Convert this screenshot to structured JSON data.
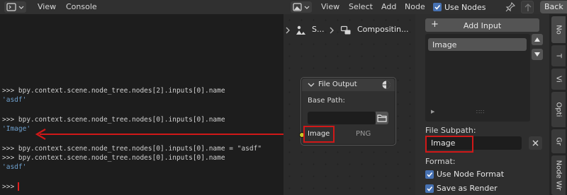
{
  "console": {
    "menus": [
      "View",
      "Console"
    ],
    "lines": [
      {
        "kind": "cmd",
        "text": ">>> bpy.context.scene.node_tree.nodes[2].inputs[0].name"
      },
      {
        "kind": "out",
        "text": "'asdf'"
      },
      {
        "kind": "cmd",
        "text": ">>> bpy.context.scene.node_tree.nodes[0].inputs[0].name"
      },
      {
        "kind": "out",
        "text": "'Image'"
      },
      {
        "kind": "cmd",
        "text": ">>> bpy.context.scene.node_tree.nodes[0].inputs[0].name = \"asdf\""
      },
      {
        "kind": "cmd",
        "text": ">>> bpy.context.scene.node_tree.nodes[0].inputs[0].name"
      },
      {
        "kind": "out",
        "text": "'asdf'"
      }
    ],
    "prompt": ">>>"
  },
  "node_editor": {
    "menus": [
      "View",
      "Select",
      "Add",
      "Node"
    ],
    "use_nodes_label": "Use Nodes",
    "use_nodes_checked": true,
    "back_label": "Back",
    "breadcrumbs": [
      "S...",
      "Compositin..."
    ],
    "node": {
      "title": "File Output",
      "base_path_label": "Base Path:",
      "base_path_value": "",
      "input_label": "Image",
      "format_label": "PNG"
    }
  },
  "sidebar": {
    "add_input_label": "Add Input",
    "list_items": [
      "Image"
    ],
    "file_subpath_label": "File Subpath:",
    "file_subpath_value": "Image",
    "format_label": "Format:",
    "use_node_format_label": "Use Node Format",
    "use_node_format_checked": true,
    "save_as_render_label": "Save as Render",
    "save_as_render_checked": true
  },
  "tabs": [
    "No",
    "T",
    "Vi",
    "Opti",
    "Gr",
    "Node Wr"
  ],
  "colors": {
    "highlight": "#d01818",
    "accent": "#4772b3",
    "socket": "#c7c729",
    "output_text": "#6fa1cf"
  }
}
